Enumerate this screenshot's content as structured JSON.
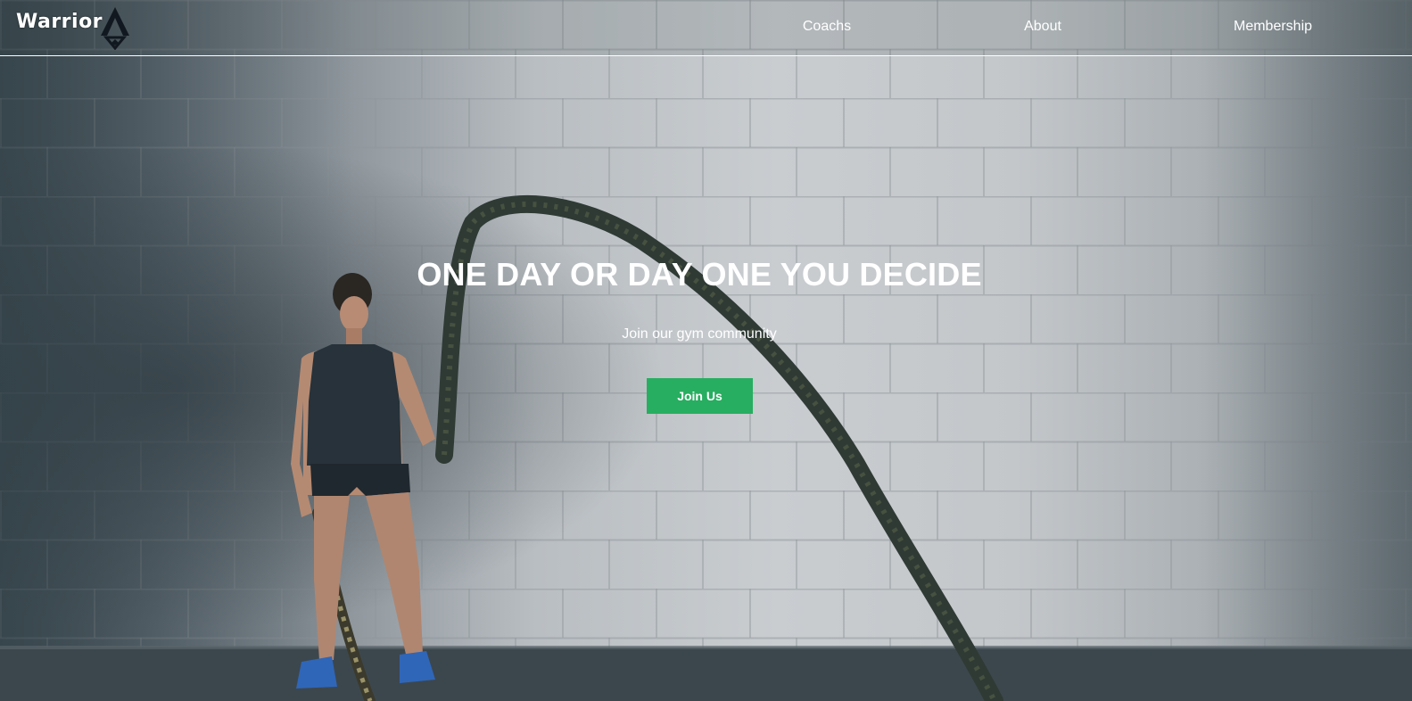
{
  "brand": {
    "name": "Warrior"
  },
  "nav": {
    "items": [
      {
        "label": "Coachs"
      },
      {
        "label": "About"
      },
      {
        "label": "Membership"
      }
    ]
  },
  "hero": {
    "title": "ONE DAY OR DAY ONE YOU DECIDE",
    "subtitle": "Join our gym community",
    "cta_label": "Join Us",
    "background_image": "woman-battle-ropes-photo"
  },
  "colors": {
    "cta": "#27ae60",
    "text": "#ffffff",
    "nav_border": "#ffffff"
  }
}
